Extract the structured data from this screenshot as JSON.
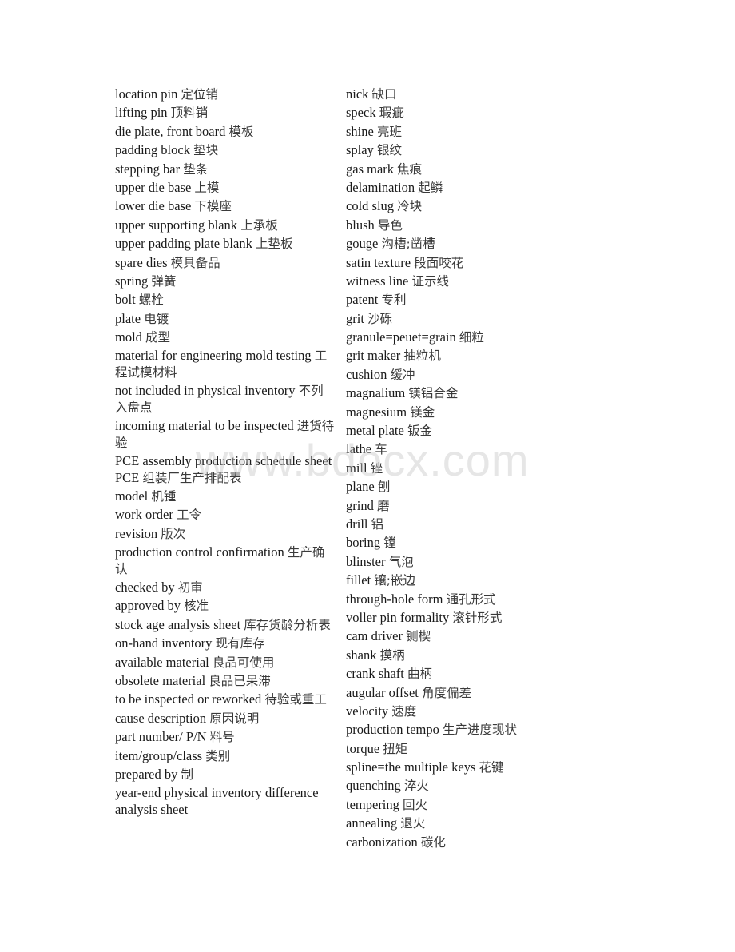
{
  "watermark": "www.bdocx.com",
  "left_column": [
    {
      "en": "location pin",
      "zh": "定位销"
    },
    {
      "en": "lifting pin",
      "zh": "顶料销"
    },
    {
      "en": "die plate, front board",
      "zh": "模板"
    },
    {
      "en": "padding block",
      "zh": "垫块"
    },
    {
      "en": "stepping bar",
      "zh": "垫条"
    },
    {
      "en": "upper die base",
      "zh": "上模"
    },
    {
      "en": "lower die base",
      "zh": "下模座"
    },
    {
      "en": "upper supporting blank",
      "zh": "上承板"
    },
    {
      "en": "upper padding plate blank",
      "zh": "上垫板"
    },
    {
      "en": "spare dies",
      "zh": "模具备品"
    },
    {
      "en": "spring",
      "zh": "弹簧"
    },
    {
      "en": "bolt",
      "zh": "螺栓"
    },
    {
      "en": "plate",
      "zh": "电镀"
    },
    {
      "en": "mold",
      "zh": "成型"
    },
    {
      "en": "material for engineering mold testing",
      "zh": "工程试模材料"
    },
    {
      "en": "not included in physical inventory",
      "zh": "不列入盘点"
    },
    {
      "en": "incoming material to be inspected",
      "zh": "进货待验"
    },
    {
      "en": "PCE assembly production schedule sheet PCE",
      "zh": "组装厂生产排配表"
    },
    {
      "en": "model",
      "zh": "机锺"
    },
    {
      "en": "work order",
      "zh": "工令"
    },
    {
      "en": "revision",
      "zh": "版次"
    },
    {
      "en": "production control confirmation",
      "zh": "生产确认"
    },
    {
      "en": "checked by",
      "zh": "初审"
    },
    {
      "en": "approved by",
      "zh": "核准"
    },
    {
      "en": "stock age analysis sheet",
      "zh": "库存货龄分析表"
    },
    {
      "en": "on-hand inventory",
      "zh": "现有库存"
    },
    {
      "en": "available material",
      "zh": "良品可使用"
    },
    {
      "en": "obsolete material",
      "zh": "良品已呆滞"
    },
    {
      "en": "to be inspected or reworked",
      "zh": "待验或重工"
    },
    {
      "en": "cause description",
      "zh": "原因说明"
    },
    {
      "en": "part number/ P/N",
      "zh": "料号"
    },
    {
      "en": "item/group/class",
      "zh": "类别"
    },
    {
      "en": "prepared by",
      "zh": "制"
    },
    {
      "en": "year-end physical inventory difference analysis sheet",
      "zh": ""
    }
  ],
  "right_column": [
    {
      "en": "nick",
      "zh": "缺口"
    },
    {
      "en": "speck",
      "zh": "瑕疵"
    },
    {
      "en": "shine",
      "zh": "亮班"
    },
    {
      "en": "splay",
      "zh": "银纹"
    },
    {
      "en": "gas mark",
      "zh": "焦痕"
    },
    {
      "en": "delamination",
      "zh": "起鳞"
    },
    {
      "en": "cold slug",
      "zh": "冷块"
    },
    {
      "en": "blush",
      "zh": "导色"
    },
    {
      "en": "gouge",
      "zh": "沟槽;凿槽"
    },
    {
      "en": "satin texture",
      "zh": "段面咬花"
    },
    {
      "en": "witness line",
      "zh": "证示线"
    },
    {
      "en": "patent",
      "zh": "专利"
    },
    {
      "en": "grit",
      "zh": "沙砾"
    },
    {
      "en": "granule=peuet=grain",
      "zh": "细粒"
    },
    {
      "en": "grit maker",
      "zh": "抽粒机"
    },
    {
      "en": "cushion",
      "zh": "缓冲"
    },
    {
      "en": "magnalium",
      "zh": "镁铝合金"
    },
    {
      "en": "magnesium",
      "zh": "镁金"
    },
    {
      "en": "metal plate",
      "zh": "钣金"
    },
    {
      "en": "lathe",
      "zh": "车"
    },
    {
      "en": "mill",
      "zh": "锉"
    },
    {
      "en": "plane",
      "zh": "刨"
    },
    {
      "en": "grind",
      "zh": "磨"
    },
    {
      "en": "drill",
      "zh": "铝"
    },
    {
      "en": "boring",
      "zh": "镗"
    },
    {
      "en": "blinster",
      "zh": "气泡"
    },
    {
      "en": "fillet",
      "zh": "镶;嵌边"
    },
    {
      "en": "through-hole form",
      "zh": "通孔形式"
    },
    {
      "en": "voller pin formality",
      "zh": "滚针形式"
    },
    {
      "en": "cam driver",
      "zh": "铡楔"
    },
    {
      "en": "shank",
      "zh": "摸柄"
    },
    {
      "en": "crank shaft",
      "zh": "曲柄"
    },
    {
      "en": "augular offset",
      "zh": "角度偏差"
    },
    {
      "en": "velocity",
      "zh": "速度"
    },
    {
      "en": "production tempo",
      "zh": "生产进度现状"
    },
    {
      "en": "torque",
      "zh": "扭矩"
    },
    {
      "en": "spline=the multiple keys",
      "zh": "花键"
    },
    {
      "en": "quenching",
      "zh": "淬火"
    },
    {
      "en": "tempering",
      "zh": "回火"
    },
    {
      "en": "annealing",
      "zh": "退火"
    },
    {
      "en": "carbonization",
      "zh": "碳化"
    }
  ]
}
